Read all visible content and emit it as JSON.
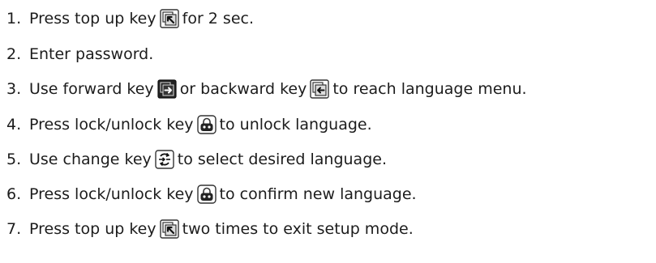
{
  "steps": [
    {
      "num": "1.",
      "parts": [
        "Press top up key",
        "for 2 sec."
      ],
      "icon": "top-up-key-icon"
    },
    {
      "num": "2.",
      "parts": [
        "Enter password."
      ]
    },
    {
      "num": "3.",
      "parts": [
        "Use forward key",
        "or backward key",
        "to reach language menu."
      ],
      "icons": [
        "forward-key-icon",
        "backward-key-icon"
      ]
    },
    {
      "num": "4.",
      "parts": [
        "Press lock/unlock key",
        "to unlock language."
      ],
      "icon": "lock-unlock-key-icon"
    },
    {
      "num": "5.",
      "parts": [
        "Use change key",
        "to select desired language."
      ],
      "icon": "change-key-icon"
    },
    {
      "num": "6.",
      "parts": [
        "Press lock/unlock key",
        "to confirm new language."
      ],
      "icon": "lock-unlock-key-icon"
    },
    {
      "num": "7.",
      "parts": [
        "Press top up key",
        "two times to exit setup mode."
      ],
      "icon": "top-up-key-icon"
    }
  ]
}
